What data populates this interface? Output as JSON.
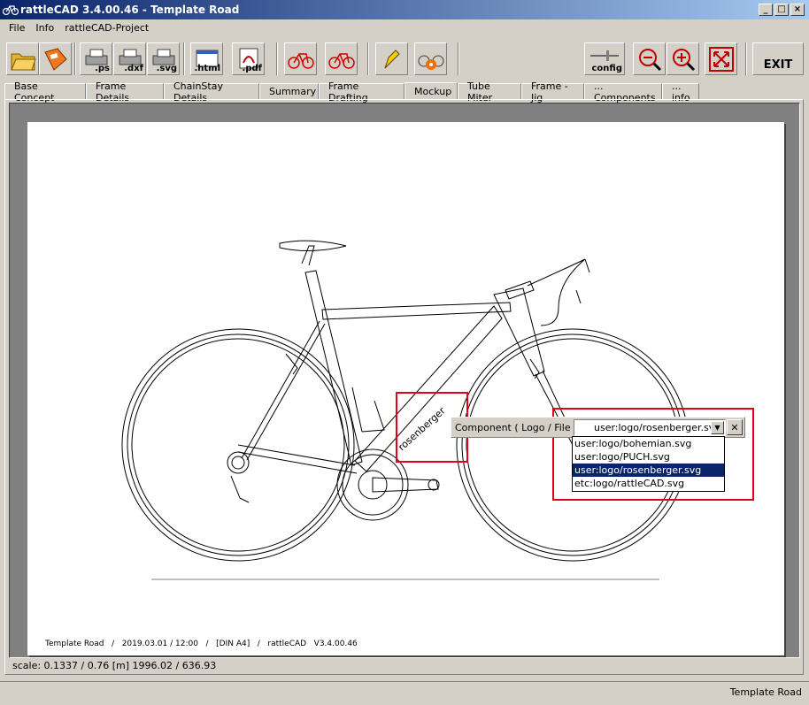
{
  "window": {
    "title": "rattleCAD  3.4.00.46 - Template Road",
    "min_glyph": "_",
    "max_glyph": "□",
    "close_glyph": "×"
  },
  "menu": [
    {
      "label": "File"
    },
    {
      "label": "Info"
    },
    {
      "label": "rattleCAD-Project"
    }
  ],
  "toolbar": {
    "buttons": [
      {
        "name": "open-button",
        "label": ""
      },
      {
        "name": "save-button",
        "label": ""
      },
      {
        "name": "export-ps-button",
        "label": ".ps"
      },
      {
        "name": "export-dxf-button",
        "label": ".dxf"
      },
      {
        "name": "export-svg-button",
        "label": ".svg"
      },
      {
        "name": "export-html-button",
        "label": ".html"
      },
      {
        "name": "export-pdf-button",
        "label": ".pdf"
      },
      {
        "name": "bike-view-1-button",
        "label": ""
      },
      {
        "name": "bike-view-2-button",
        "label": ""
      },
      {
        "name": "pen-button",
        "label": ""
      },
      {
        "name": "bike-render-button",
        "label": ""
      },
      {
        "name": "config-button",
        "label": "config"
      },
      {
        "name": "zoom-out-button",
        "label": ""
      },
      {
        "name": "zoom-in-button",
        "label": ""
      },
      {
        "name": "fit-button",
        "label": ""
      },
      {
        "name": "exit-button",
        "label": "EXIT"
      }
    ]
  },
  "tabs": [
    {
      "label": "Base Concept"
    },
    {
      "label": "Frame Details"
    },
    {
      "label": "ChainStay Details"
    },
    {
      "label": "Summary"
    },
    {
      "label": "Frame Drafting"
    },
    {
      "label": "Mockup"
    },
    {
      "label": "Tube Miter"
    },
    {
      "label": "Frame - Jig"
    },
    {
      "label": "... Components"
    },
    {
      "label": "... info"
    }
  ],
  "active_tab": "Mockup",
  "drawing": {
    "footer": "Template Road   /   2019.03.01 / 12:00   /   [DIN A4]   /   rattleCAD   V3.4.00.46",
    "logo_text": "rosenberger"
  },
  "component_editor": {
    "label": "Component ( Logo / File ) :",
    "value": "user:logo/rosenberger.svg",
    "options": [
      {
        "label": "user:logo/bohemian.svg",
        "selected": false
      },
      {
        "label": "user:logo/PUCH.svg",
        "selected": false
      },
      {
        "label": "user:logo/rosenberger.svg",
        "selected": true
      },
      {
        "label": "etc:logo/rattleCAD.svg",
        "selected": false
      }
    ],
    "close_glyph": "✕"
  },
  "scale_text": "scale: 0.1337 / 0.76  [m]  1996.02 / 636.93",
  "status": {
    "text": "Template Road"
  },
  "colors": {
    "highlight": "#e0001a",
    "selection": "#0a246a",
    "titlebar": "#0a246a"
  }
}
